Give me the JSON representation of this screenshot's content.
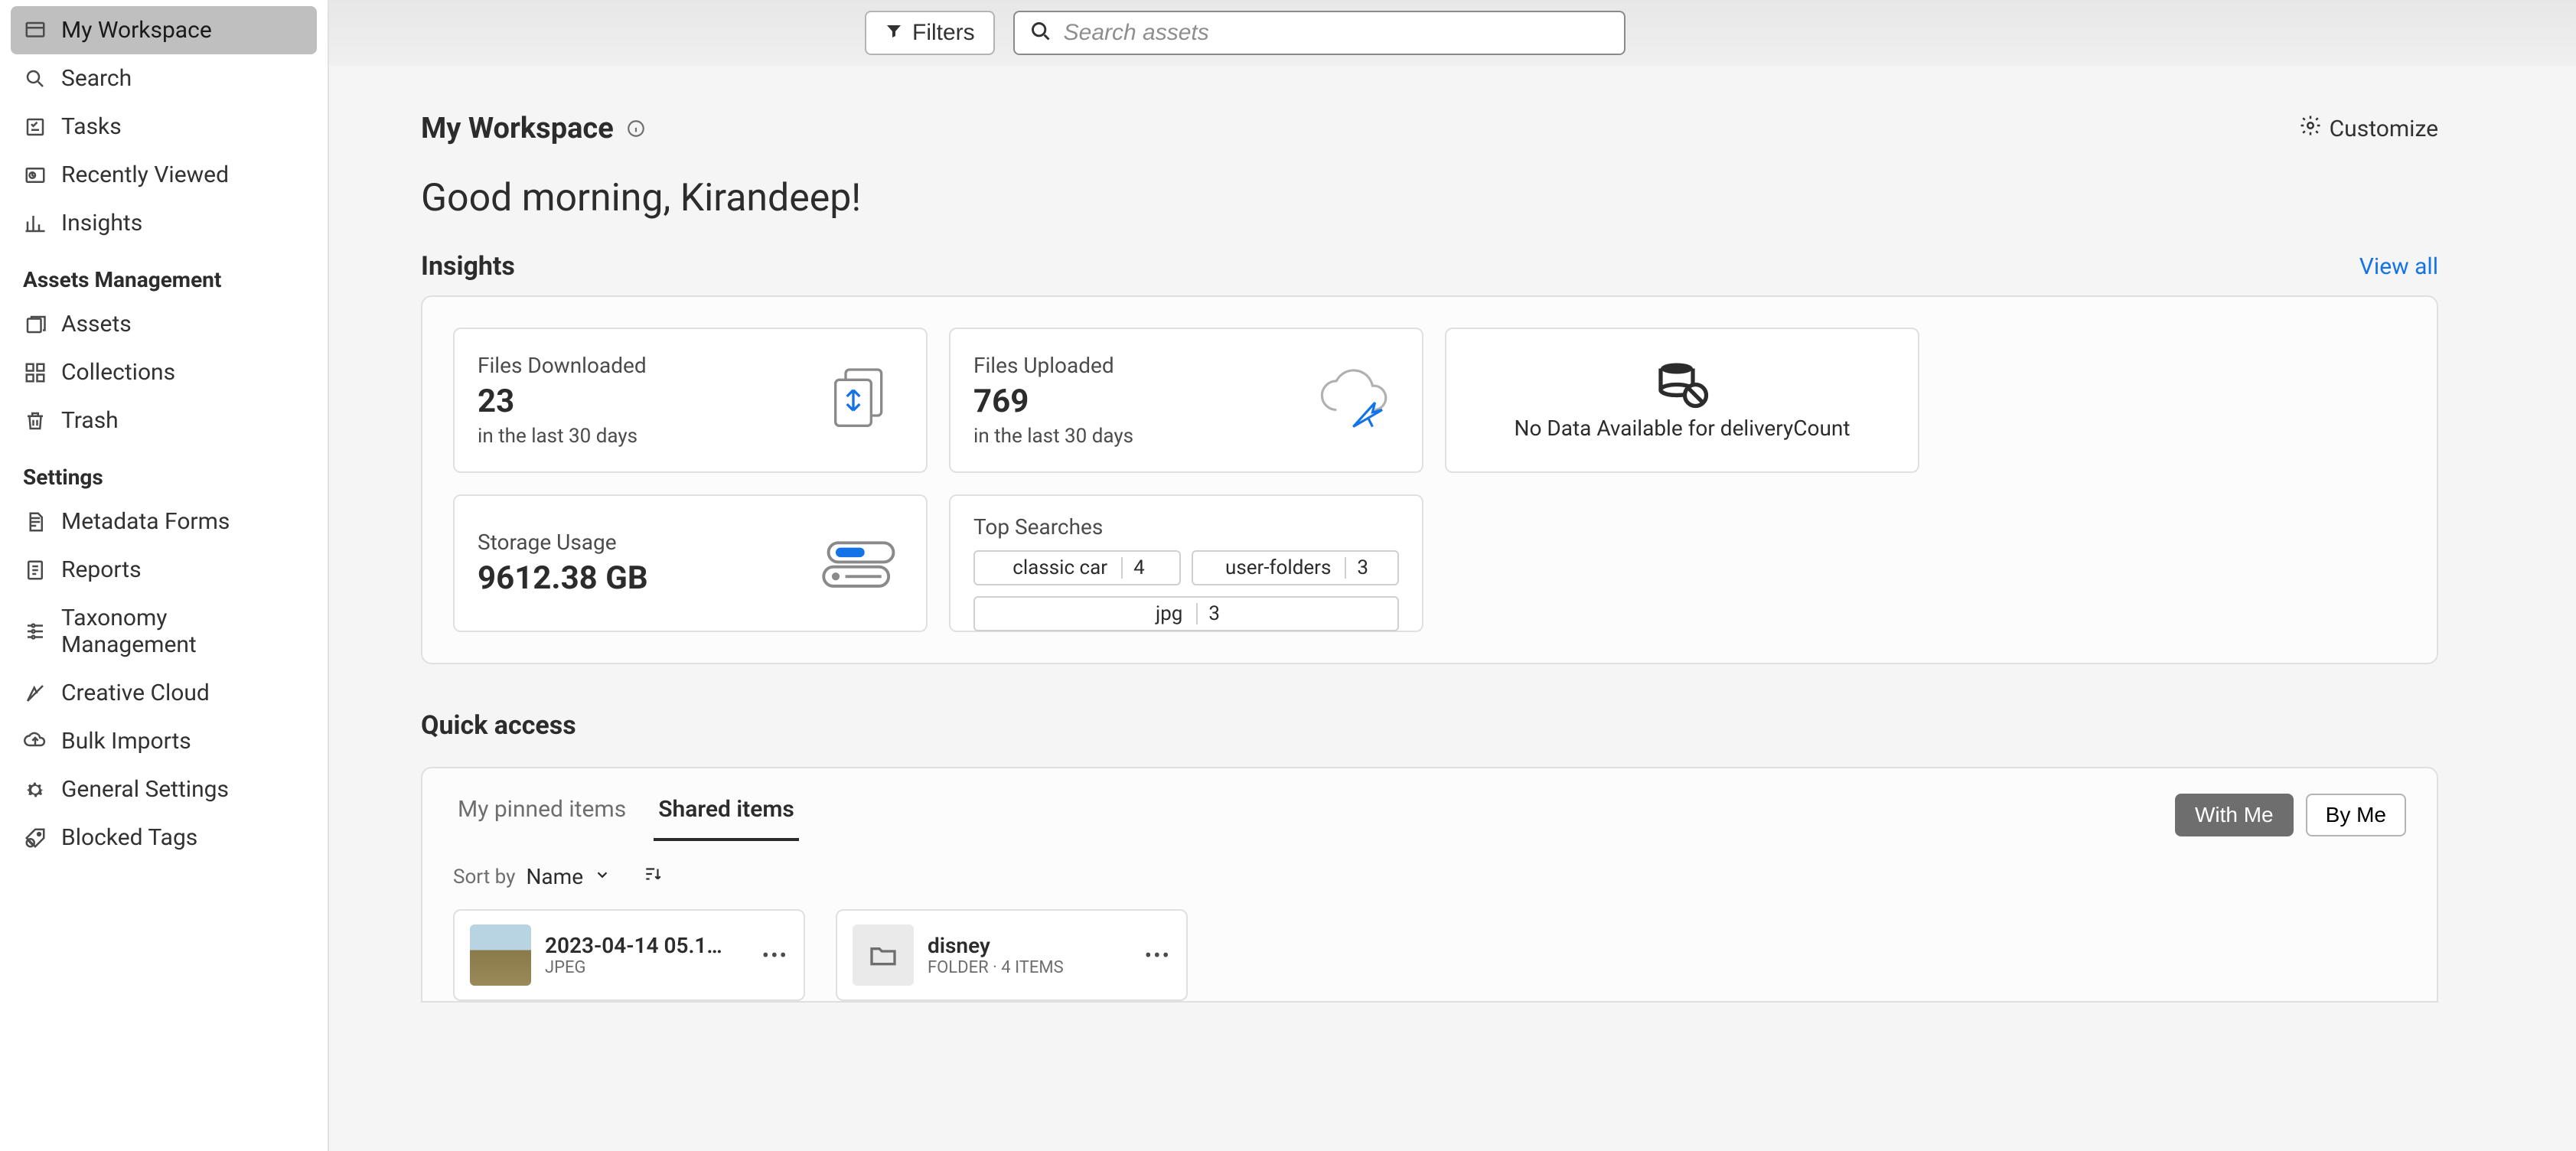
{
  "sidebar": {
    "items": [
      {
        "label": "My Workspace",
        "icon": "workspace-icon",
        "active": true
      },
      {
        "label": "Search",
        "icon": "search-icon"
      },
      {
        "label": "Tasks",
        "icon": "tasks-icon"
      },
      {
        "label": "Recently Viewed",
        "icon": "recent-icon"
      },
      {
        "label": "Insights",
        "icon": "insights-icon"
      }
    ],
    "group_assets": {
      "heading": "Assets Management",
      "items": [
        {
          "label": "Assets",
          "icon": "assets-icon"
        },
        {
          "label": "Collections",
          "icon": "collections-icon"
        },
        {
          "label": "Trash",
          "icon": "trash-icon"
        }
      ]
    },
    "group_settings": {
      "heading": "Settings",
      "items": [
        {
          "label": "Metadata Forms",
          "icon": "metadata-icon"
        },
        {
          "label": "Reports",
          "icon": "reports-icon"
        },
        {
          "label": "Taxonomy Management",
          "icon": "taxonomy-icon"
        },
        {
          "label": "Creative Cloud",
          "icon": "creative-icon"
        },
        {
          "label": "Bulk Imports",
          "icon": "bulk-icon"
        },
        {
          "label": "General Settings",
          "icon": "gear-icon"
        },
        {
          "label": "Blocked Tags",
          "icon": "blocked-icon"
        }
      ]
    }
  },
  "topbar": {
    "filters_label": "Filters",
    "search_placeholder": "Search assets"
  },
  "header": {
    "title": "My Workspace",
    "customize_label": "Customize",
    "greeting": "Good morning, Kirandeep!"
  },
  "insights": {
    "title": "Insights",
    "view_all": "View all",
    "cards": {
      "downloaded": {
        "label": "Files Downloaded",
        "value": "23",
        "sub": "in the last 30 days"
      },
      "uploaded": {
        "label": "Files Uploaded",
        "value": "769",
        "sub": "in the last 30 days"
      },
      "nodata": {
        "text": "No Data Available for deliveryCount"
      },
      "storage": {
        "label": "Storage Usage",
        "value": "9612.38 GB"
      },
      "top_searches": {
        "label": "Top Searches",
        "chips": [
          {
            "term": "classic car",
            "count": "4"
          },
          {
            "term": "user-folders",
            "count": "3"
          },
          {
            "term": "jpg",
            "count": "3"
          }
        ]
      }
    }
  },
  "quick_access": {
    "title": "Quick access",
    "tabs": {
      "pinned": "My pinned items",
      "shared": "Shared items"
    },
    "filters": {
      "with_me": "With Me",
      "by_me": "By Me"
    },
    "sort": {
      "label": "Sort by",
      "value": "Name"
    },
    "items": [
      {
        "name": "2023-04-14 05.1…",
        "meta": "JPEG",
        "thumb": "landscape"
      },
      {
        "name": "disney",
        "meta": "FOLDER · 4 ITEMS",
        "thumb": "folder"
      }
    ]
  }
}
